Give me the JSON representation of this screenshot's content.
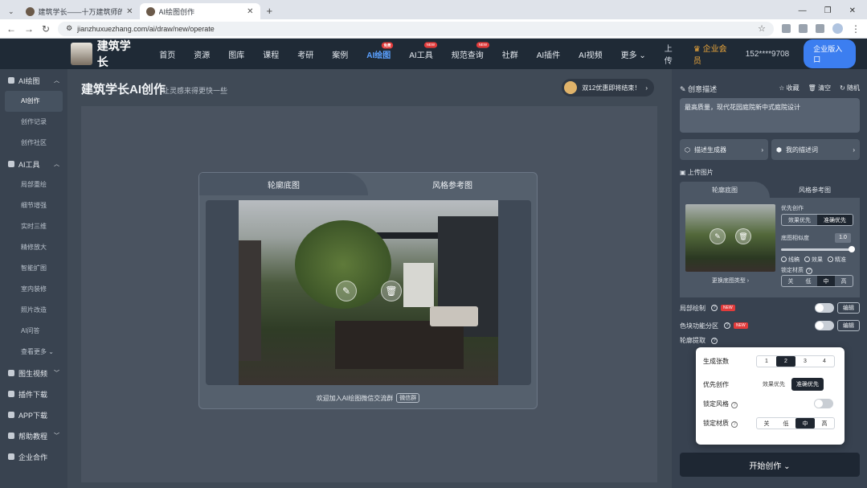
{
  "browser": {
    "tabs": [
      {
        "title": "建筑学长——十万建筑师的资源",
        "active": false
      },
      {
        "title": "AI绘图创作",
        "active": true
      }
    ],
    "new_tab": "+",
    "url": "jianzhuxuezhang.com/ai/draw/new/operate"
  },
  "header": {
    "brand": "建筑学长",
    "nav": [
      {
        "label": "首页"
      },
      {
        "label": "资源"
      },
      {
        "label": "图库"
      },
      {
        "label": "课程"
      },
      {
        "label": "考研"
      },
      {
        "label": "案例"
      },
      {
        "label": "AI绘图",
        "badge": "免费",
        "hot": true
      },
      {
        "label": "AI工具",
        "badge": "NEW"
      },
      {
        "label": "规范查询",
        "badge": "NEW"
      },
      {
        "label": "社群"
      },
      {
        "label": "AI插件"
      },
      {
        "label": "AI视频"
      },
      {
        "label": "更多 ⌄"
      }
    ],
    "upload": "上传",
    "vip": "企业会员",
    "phone": "152****9708",
    "cta": "企业版入口"
  },
  "sidebar": {
    "groups": [
      {
        "label": "AI绘图",
        "items": [
          "AI创作",
          "创作记录",
          "创作社区"
        ]
      },
      {
        "label": "AI工具",
        "items": [
          "局部重绘",
          "细节增强",
          "实时三维",
          "精修放大",
          "智能扩图",
          "室内装修",
          "照片改造",
          "AI问答",
          "查看更多 ⌄"
        ]
      }
    ],
    "bottom": [
      "图生视频",
      "插件下载",
      "APP下载",
      "帮助教程",
      "企业合作"
    ]
  },
  "main": {
    "title": "建筑学长AI创作",
    "subtitle": "让灵感来得更快一些",
    "promo": "双12优惠即将结束！",
    "panel_tabs": [
      "轮廓底图",
      "风格参考图"
    ],
    "footer_text": "欢迎加入AI绘图微信交流群",
    "footer_chip": "微信群"
  },
  "right": {
    "title": "创意描述",
    "actions": [
      "收藏",
      "清空",
      "随机"
    ],
    "prompt": "最高质量，现代花园庭院新中式庭院设计",
    "btn_generator": "描述生成器",
    "btn_my_desc": "我的描述词",
    "upload_label": "上传图片",
    "tabs": [
      "轮廓底图",
      "风格参考图"
    ],
    "change_type": "更换底图类型 ›",
    "priority_label": "优先创作",
    "priority_opts": [
      "效果优先",
      "准确优先"
    ],
    "priority_selected": 1,
    "similarity_label": "底图相似度",
    "similarity_value": "1.0",
    "modes": [
      "线稿",
      "效果",
      "精准"
    ],
    "modes_selected": 2,
    "lock_label": "锁定材质",
    "lock_opts": [
      "关",
      "低",
      "中",
      "高"
    ],
    "lock_selected": 2,
    "local_draw": "局部绘制",
    "color_zone": "色块功能分区",
    "new_tag": "NEW",
    "edit": "编辑",
    "outline_label": "轮廓提取",
    "generate": "开始创作 ⌄"
  },
  "popup": {
    "count_label": "生成张数",
    "count_opts": [
      "1",
      "2",
      "3",
      "4"
    ],
    "count_selected": 1,
    "priority_label": "优先创作",
    "priority_opts": [
      "效果优先",
      "准确优先"
    ],
    "lock_style_label": "锁定风格",
    "lock_material_label": "锁定材质",
    "lock_opts": [
      "关",
      "低",
      "中",
      "高"
    ],
    "lock_selected": 2
  }
}
